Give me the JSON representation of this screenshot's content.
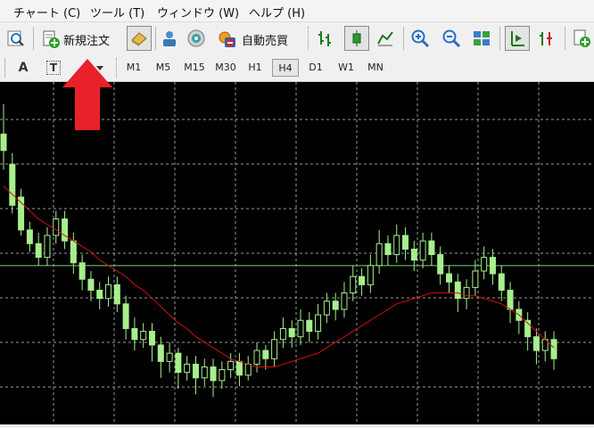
{
  "menu": {
    "items": [
      "チャート (C)",
      "ツール (T)",
      "ウィンドウ (W)",
      "ヘルプ (H)"
    ]
  },
  "toolbar": {
    "new_order_label": "新規注文",
    "auto_trade_label": "自動売買",
    "icons": [
      "chart-properties-icon",
      "new-order-icon",
      "navigator-icon",
      "terminal-icon",
      "signals-icon",
      "auto-trading-icon",
      "bar-chart-icon",
      "candlestick-icon",
      "line-chart-icon",
      "zoom-in-icon",
      "zoom-out-icon",
      "tile-windows-icon",
      "auto-scroll-icon",
      "chart-shift-icon",
      "add-icon"
    ]
  },
  "draw_tools": {
    "text_label": "A",
    "text_label_icon": "T"
  },
  "timeframes": {
    "items": [
      "M1",
      "M5",
      "M15",
      "M30",
      "H1",
      "H4",
      "D1",
      "W1",
      "MN"
    ],
    "active": "H4"
  },
  "annotation": {
    "arrow_color": "#e8202a"
  },
  "chart_data": {
    "type": "candlestick",
    "background": "#000000",
    "candle_color": "#a6f08c",
    "ma_color": "#d01010",
    "grid": true,
    "grid_style": "dashed",
    "hline_color": "#7fd07a",
    "candles": [
      [
        0.81,
        0.75,
        0.92,
        0.68
      ],
      [
        0.7,
        0.55,
        0.74,
        0.52
      ],
      [
        0.58,
        0.46,
        0.61,
        0.44
      ],
      [
        0.46,
        0.41,
        0.49,
        0.38
      ],
      [
        0.41,
        0.36,
        0.45,
        0.33
      ],
      [
        0.36,
        0.44,
        0.47,
        0.33
      ],
      [
        0.44,
        0.5,
        0.53,
        0.41
      ],
      [
        0.5,
        0.42,
        0.53,
        0.39
      ],
      [
        0.42,
        0.34,
        0.45,
        0.3
      ],
      [
        0.34,
        0.28,
        0.37,
        0.24
      ],
      [
        0.28,
        0.24,
        0.31,
        0.2
      ],
      [
        0.24,
        0.21,
        0.27,
        0.17
      ],
      [
        0.21,
        0.26,
        0.29,
        0.18
      ],
      [
        0.26,
        0.19,
        0.29,
        0.16
      ],
      [
        0.19,
        0.1,
        0.22,
        0.06
      ],
      [
        0.1,
        0.06,
        0.14,
        0.02
      ],
      [
        0.06,
        0.09,
        0.12,
        0.03
      ],
      [
        0.09,
        0.04,
        0.12,
        -0.02
      ],
      [
        0.04,
        -0.02,
        0.07,
        -0.08
      ],
      [
        -0.02,
        0.01,
        0.05,
        -0.06
      ],
      [
        0.01,
        -0.06,
        0.03,
        -0.12
      ],
      [
        -0.06,
        -0.03,
        0.0,
        -0.09
      ],
      [
        -0.03,
        -0.08,
        0.0,
        -0.14
      ],
      [
        -0.08,
        -0.04,
        -0.01,
        -0.11
      ],
      [
        -0.04,
        -0.09,
        -0.01,
        -0.15
      ],
      [
        -0.09,
        -0.05,
        -0.02,
        -0.12
      ],
      [
        -0.05,
        -0.02,
        0.01,
        -0.08
      ],
      [
        -0.02,
        -0.07,
        0.01,
        -0.11
      ],
      [
        -0.07,
        -0.03,
        0.0,
        -0.09
      ],
      [
        -0.03,
        0.02,
        0.05,
        -0.06
      ],
      [
        0.02,
        -0.01,
        0.04,
        -0.05
      ],
      [
        -0.01,
        0.06,
        0.09,
        -0.04
      ],
      [
        0.06,
        0.1,
        0.14,
        0.03
      ],
      [
        0.1,
        0.07,
        0.13,
        0.03
      ],
      [
        0.07,
        0.13,
        0.17,
        0.04
      ],
      [
        0.13,
        0.09,
        0.16,
        0.05
      ],
      [
        0.09,
        0.15,
        0.19,
        0.06
      ],
      [
        0.15,
        0.2,
        0.23,
        0.12
      ],
      [
        0.2,
        0.17,
        0.23,
        0.13
      ],
      [
        0.17,
        0.23,
        0.27,
        0.14
      ],
      [
        0.23,
        0.29,
        0.33,
        0.2
      ],
      [
        0.29,
        0.26,
        0.32,
        0.22
      ],
      [
        0.26,
        0.33,
        0.37,
        0.23
      ],
      [
        0.33,
        0.41,
        0.46,
        0.3
      ],
      [
        0.41,
        0.37,
        0.44,
        0.33
      ],
      [
        0.37,
        0.44,
        0.48,
        0.34
      ],
      [
        0.44,
        0.39,
        0.47,
        0.35
      ],
      [
        0.39,
        0.35,
        0.42,
        0.31
      ],
      [
        0.35,
        0.42,
        0.45,
        0.32
      ],
      [
        0.42,
        0.37,
        0.45,
        0.33
      ],
      [
        0.37,
        0.3,
        0.4,
        0.26
      ],
      [
        0.3,
        0.27,
        0.33,
        0.23
      ],
      [
        0.27,
        0.21,
        0.3,
        0.16
      ],
      [
        0.21,
        0.25,
        0.28,
        0.17
      ],
      [
        0.25,
        0.31,
        0.35,
        0.22
      ],
      [
        0.31,
        0.36,
        0.4,
        0.28
      ],
      [
        0.36,
        0.3,
        0.39,
        0.26
      ],
      [
        0.3,
        0.24,
        0.33,
        0.2
      ],
      [
        0.24,
        0.17,
        0.27,
        0.12
      ],
      [
        0.17,
        0.13,
        0.2,
        0.08
      ],
      [
        0.13,
        0.07,
        0.16,
        0.02
      ],
      [
        0.07,
        0.02,
        0.1,
        -0.03
      ],
      [
        0.02,
        0.06,
        0.09,
        -0.02
      ],
      [
        0.06,
        -0.01,
        0.09,
        -0.05
      ]
    ],
    "ma": [
      0.62,
      0.59,
      0.56,
      0.53,
      0.5,
      0.48,
      0.46,
      0.44,
      0.42,
      0.4,
      0.38,
      0.35,
      0.33,
      0.31,
      0.29,
      0.26,
      0.24,
      0.21,
      0.18,
      0.15,
      0.12,
      0.1,
      0.07,
      0.05,
      0.03,
      0.01,
      -0.01,
      -0.02,
      -0.03,
      -0.04,
      -0.04,
      -0.04,
      -0.03,
      -0.02,
      -0.01,
      0.0,
      0.01,
      0.03,
      0.05,
      0.07,
      0.09,
      0.11,
      0.13,
      0.15,
      0.17,
      0.19,
      0.2,
      0.21,
      0.22,
      0.23,
      0.23,
      0.23,
      0.23,
      0.22,
      0.22,
      0.21,
      0.2,
      0.19,
      0.17,
      0.15,
      0.12,
      0.09,
      0.06,
      0.03
    ],
    "hline_value": 0.33,
    "ylim": [
      -0.25,
      1.0
    ]
  }
}
